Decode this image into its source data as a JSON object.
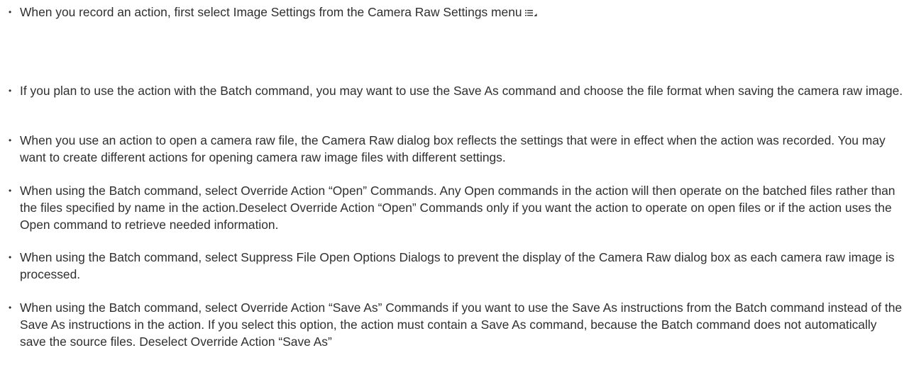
{
  "items": [
    {
      "text": "When you record an action, first select Image Settings from the Camera Raw Settings menu",
      "icon": "settings-menu-icon"
    },
    {
      "text": "If you plan to use the action with the Batch command, you may want to use the Save As command and choose the file format when saving the camera raw image."
    },
    {
      "text": "When you use an action to open a camera raw file, the Camera Raw dialog box reflects the settings that were in effect when the action was recorded. You may want to create different actions for opening camera raw image files with different settings."
    },
    {
      "text": "When using the Batch command, select Override Action “Open” Commands. Any Open commands in the action will then operate on the batched files rather than the files specified by name in the action.Deselect Override Action “Open” Commands only if you want the action to operate on open files or if the action uses the Open command to retrieve needed information."
    },
    {
      "text": "When using the Batch command, select Suppress File Open Options Dialogs to prevent the display of the Camera Raw dialog box as each camera raw image is processed."
    },
    {
      "text": "When using the Batch command, select Override Action “Save As” Commands if you want to use the Save As instructions from the Batch command instead of the Save As instructions in the action. If you select this option, the action must contain a Save As command, because the Batch command does not automatically save the source files. Deselect Override Action “Save As”"
    }
  ],
  "bullet_glyph": "•"
}
